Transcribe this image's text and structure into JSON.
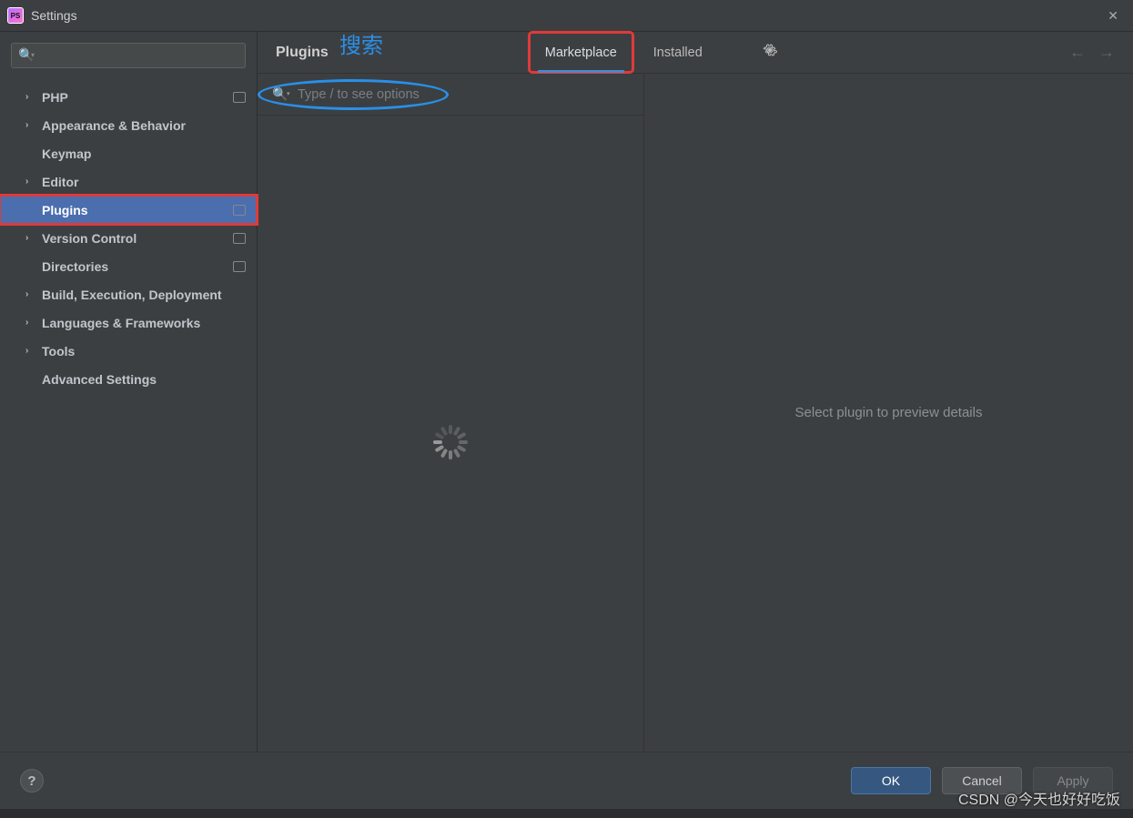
{
  "window": {
    "title": "Settings",
    "app_badge": "PS"
  },
  "sidebar": {
    "items": [
      {
        "label": "PHP",
        "expandable": true,
        "badge": true
      },
      {
        "label": "Appearance & Behavior",
        "expandable": true
      },
      {
        "label": "Keymap",
        "expandable": false
      },
      {
        "label": "Editor",
        "expandable": true
      },
      {
        "label": "Plugins",
        "expandable": false,
        "selected": true,
        "badge": true
      },
      {
        "label": "Version Control",
        "expandable": true,
        "badge": true
      },
      {
        "label": "Directories",
        "expandable": false,
        "badge": true
      },
      {
        "label": "Build, Execution, Deployment",
        "expandable": true
      },
      {
        "label": "Languages & Frameworks",
        "expandable": true
      },
      {
        "label": "Tools",
        "expandable": true
      },
      {
        "label": "Advanced Settings",
        "expandable": false
      }
    ]
  },
  "main": {
    "title": "Plugins",
    "tabs": {
      "marketplace": "Marketplace",
      "installed": "Installed"
    },
    "search_placeholder": "Type / to see options",
    "detail_placeholder": "Select plugin to preview details"
  },
  "annotations": {
    "search_label": "搜索"
  },
  "footer": {
    "ok": "OK",
    "cancel": "Cancel",
    "apply": "Apply"
  },
  "watermark": "CSDN @今天也好好吃饭"
}
